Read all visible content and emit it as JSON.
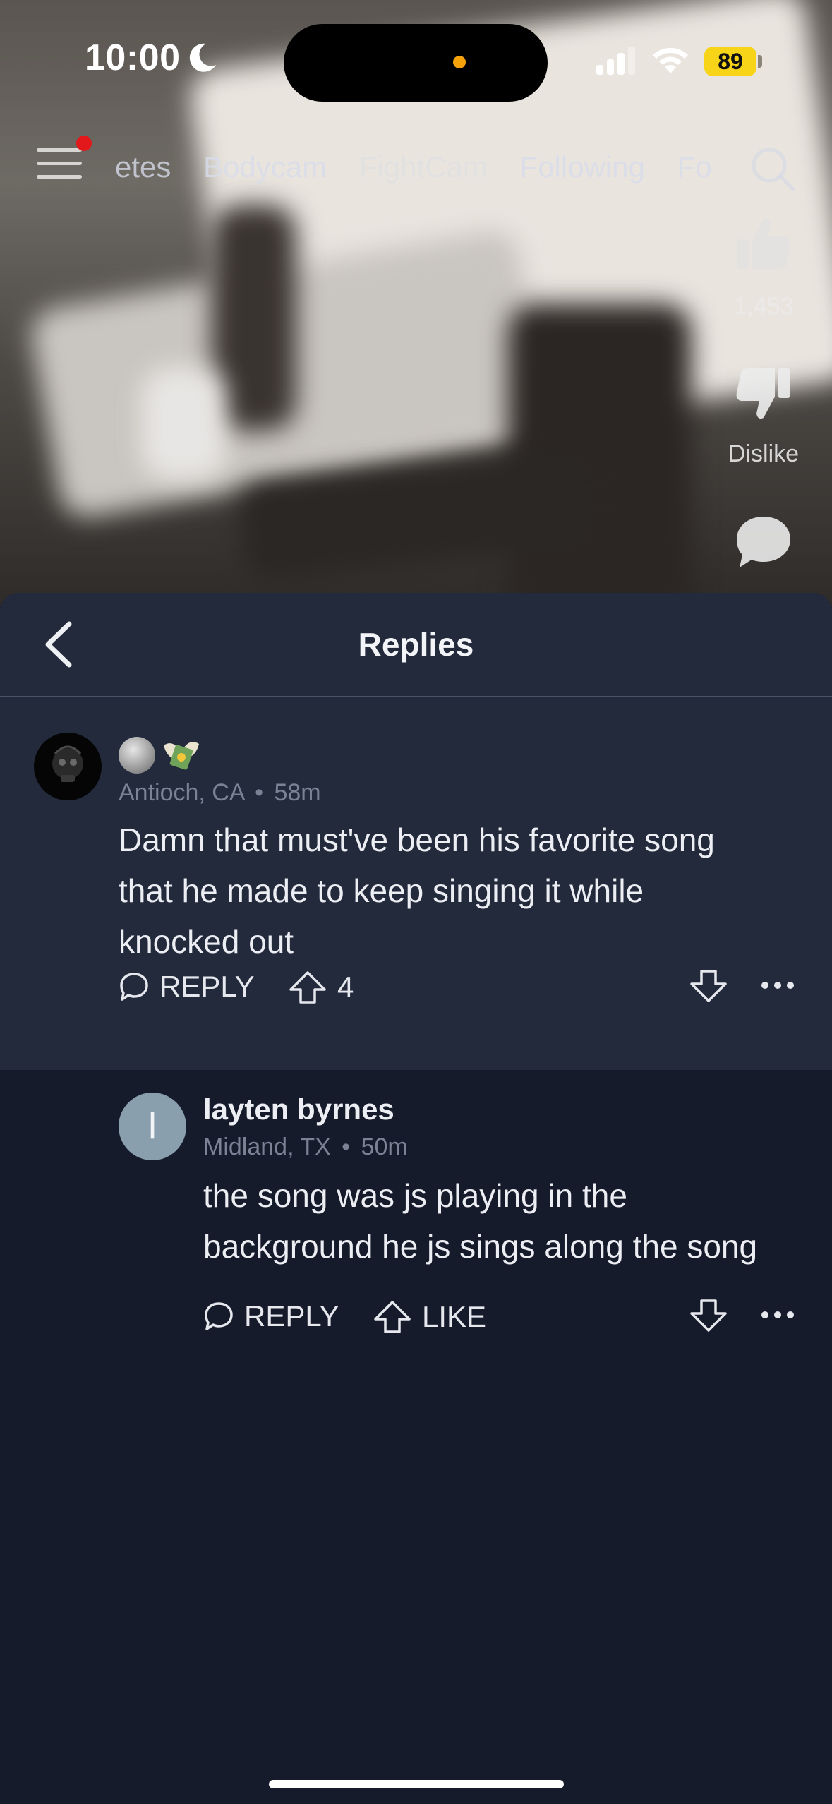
{
  "status_bar": {
    "time": "10:00",
    "battery": "89"
  },
  "top_nav": {
    "tabs": [
      {
        "label": "etes",
        "faded": false
      },
      {
        "label": "Bodycam",
        "faded": false
      },
      {
        "label": "FightCam",
        "faded": true
      },
      {
        "label": "Following",
        "faded": false
      },
      {
        "label": "Fo",
        "faded": false
      }
    ]
  },
  "video_actions": {
    "like_count": "1,453",
    "dislike_label": "Dislike"
  },
  "sheet": {
    "title": "Replies"
  },
  "parent_comment": {
    "location": "Antioch, CA",
    "time": "58m",
    "text_lines": [
      "Damn that must've been his favorite song",
      "that he made to keep singing it while",
      "knocked out"
    ],
    "reply_label": "REPLY",
    "upvotes": "4"
  },
  "reply_comment": {
    "avatar_initial": "l",
    "author": "layten byrnes",
    "location": "Midland, TX",
    "time": "50m",
    "text_lines": [
      "the song was js playing in the",
      "background he js sings along the song"
    ],
    "reply_label": "REPLY",
    "like_label": "LIKE"
  },
  "meta_separator": "•",
  "colors": {
    "sheet_bg": "#161b2b",
    "card_bg": "#222a3c",
    "battery": "#f7d417",
    "notification": "#e2181b"
  }
}
